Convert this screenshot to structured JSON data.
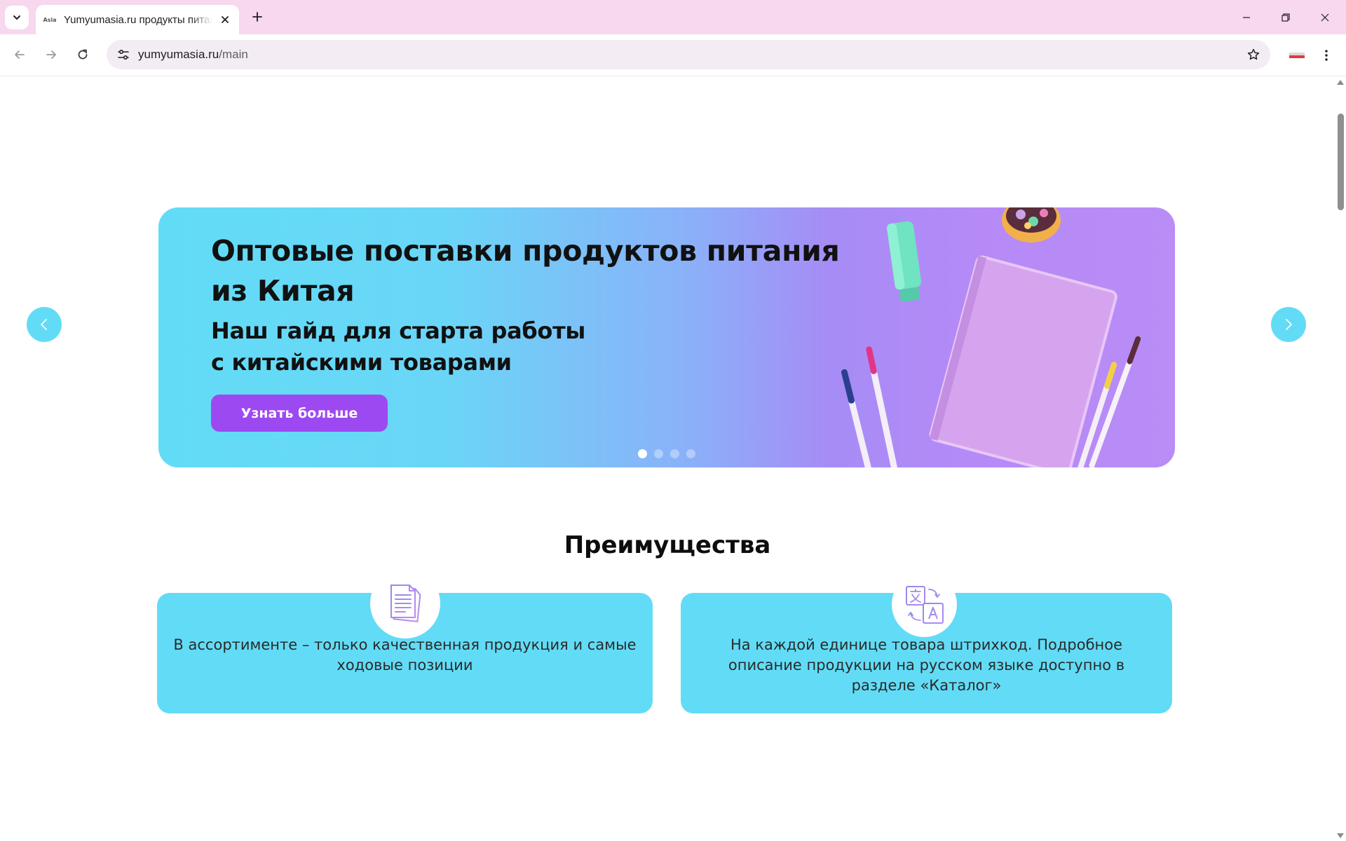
{
  "browser": {
    "tab_title": "Yumyumasia.ru продукты питания",
    "favicon_text": "Asia",
    "url_host": "yumyumasia.ru",
    "url_path": "/main"
  },
  "hero": {
    "title": "Оптовые поставки продуктов питания из Китая",
    "subtitle": "Наш гайд для старта работы с китайскими товарами",
    "cta_label": "Узнать больше",
    "slides_total": 4,
    "active_slide": 1
  },
  "advantages": {
    "heading": "Преимущества",
    "cards": [
      {
        "icon": "document-icon",
        "text": "В ассортименте – только качественная продукция и самые ходовые позиции"
      },
      {
        "icon": "translate-icon",
        "text": "На каждой единице товара штрихкод. Подробное описание продукции на русском языке доступно в разделе «Каталог»"
      }
    ]
  },
  "colors": {
    "accent_cyan": "#62dcf6",
    "accent_purple": "#9d49f2",
    "tabbar_pink": "#f7d8ee"
  }
}
